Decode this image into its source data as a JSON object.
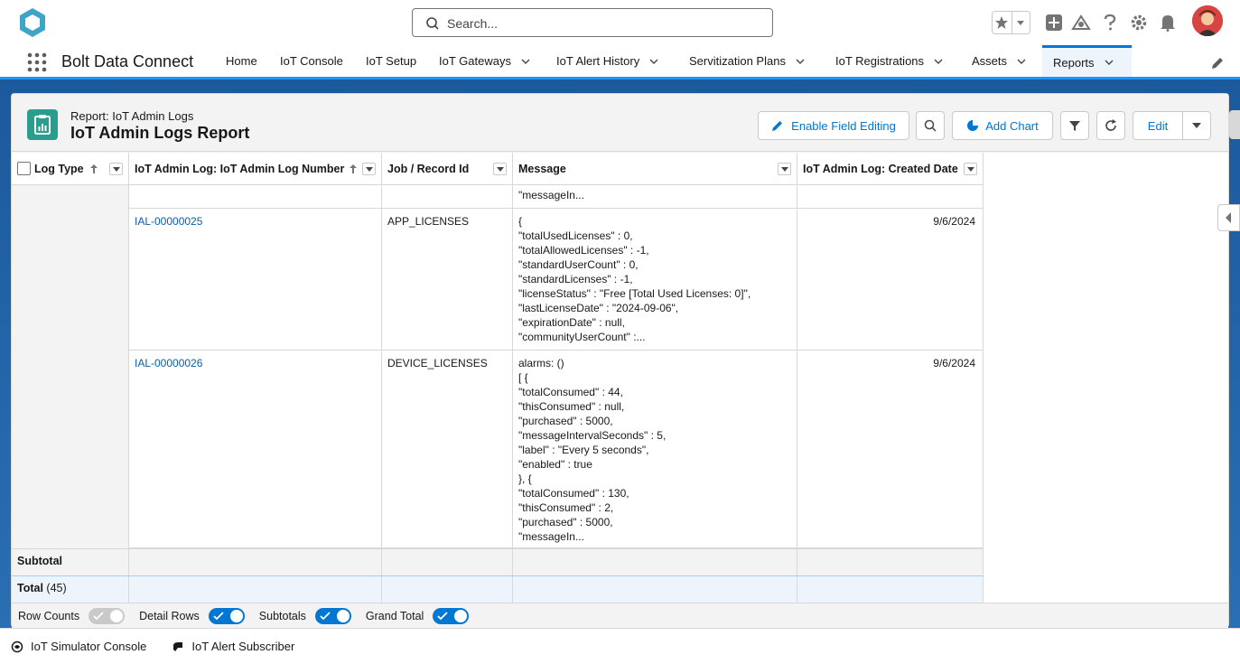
{
  "header": {
    "search_placeholder": "Search..."
  },
  "nav": {
    "app_name": "Bolt Data Connect",
    "tabs": [
      {
        "label": "Home",
        "has_menu": false
      },
      {
        "label": "IoT Console",
        "has_menu": false
      },
      {
        "label": "IoT Setup",
        "has_menu": false
      },
      {
        "label": "IoT Gateways",
        "has_menu": true
      },
      {
        "label": "IoT Alert History",
        "has_menu": true
      },
      {
        "label": "Servitization Plans",
        "has_menu": true
      },
      {
        "label": "IoT Registrations",
        "has_menu": true
      },
      {
        "label": "Assets",
        "has_menu": true
      },
      {
        "label": "Reports",
        "has_menu": true,
        "active": true
      }
    ]
  },
  "report": {
    "type_label": "Report: IoT Admin Logs",
    "title": "IoT Admin Logs Report",
    "buttons": {
      "enable_field_editing": "Enable Field Editing",
      "add_chart": "Add Chart",
      "edit": "Edit"
    },
    "columns": [
      "Log Type",
      "IoT Admin Log: IoT Admin Log Number",
      "Job / Record Id",
      "Message",
      "IoT Admin Log: Created Date"
    ],
    "partial_row_message": "\"messageIn...",
    "rows": [
      {
        "number": "IAL-00000025",
        "job": "APP_LICENSES",
        "message": "{\n\"totalUsedLicenses\" : 0,\n\"totalAllowedLicenses\" : -1,\n\"standardUserCount\" : 0,\n\"standardLicenses\" : -1,\n\"licenseStatus\" : \"Free [Total Used Licenses: 0]\",\n\"lastLicenseDate\" : \"2024-09-06\",\n\"expirationDate\" : null,\n\"communityUserCount\" :...",
        "date": "9/6/2024"
      },
      {
        "number": "IAL-00000026",
        "job": "DEVICE_LICENSES",
        "message": "alarms: ()\n[ {\n\"totalConsumed\" : 44,\n\"thisConsumed\" : null,\n\"purchased\" : 5000,\n\"messageIntervalSeconds\" : 5,\n\"label\" : \"Every 5 seconds\",\n\"enabled\" : true\n}, {\n\"totalConsumed\" : 130,\n\"thisConsumed\" : 2,\n\"purchased\" : 5000,\n\"messageIn...",
        "date": "9/6/2024"
      }
    ],
    "subtotal_label": "Subtotal",
    "total_label": "Total",
    "total_count": "(45)",
    "toggles": [
      {
        "label": "Row Counts",
        "on": false
      },
      {
        "label": "Detail Rows",
        "on": true
      },
      {
        "label": "Subtotals",
        "on": true
      },
      {
        "label": "Grand Total",
        "on": true
      }
    ]
  },
  "utility_bar": {
    "items": [
      "IoT Simulator Console",
      "IoT Alert Subscriber"
    ]
  },
  "colors": {
    "brand_blue": "#0176d3",
    "toggle_on": "#0176d3",
    "toggle_off": "#c9c9c9",
    "report_icon": "#2a9d8f"
  }
}
